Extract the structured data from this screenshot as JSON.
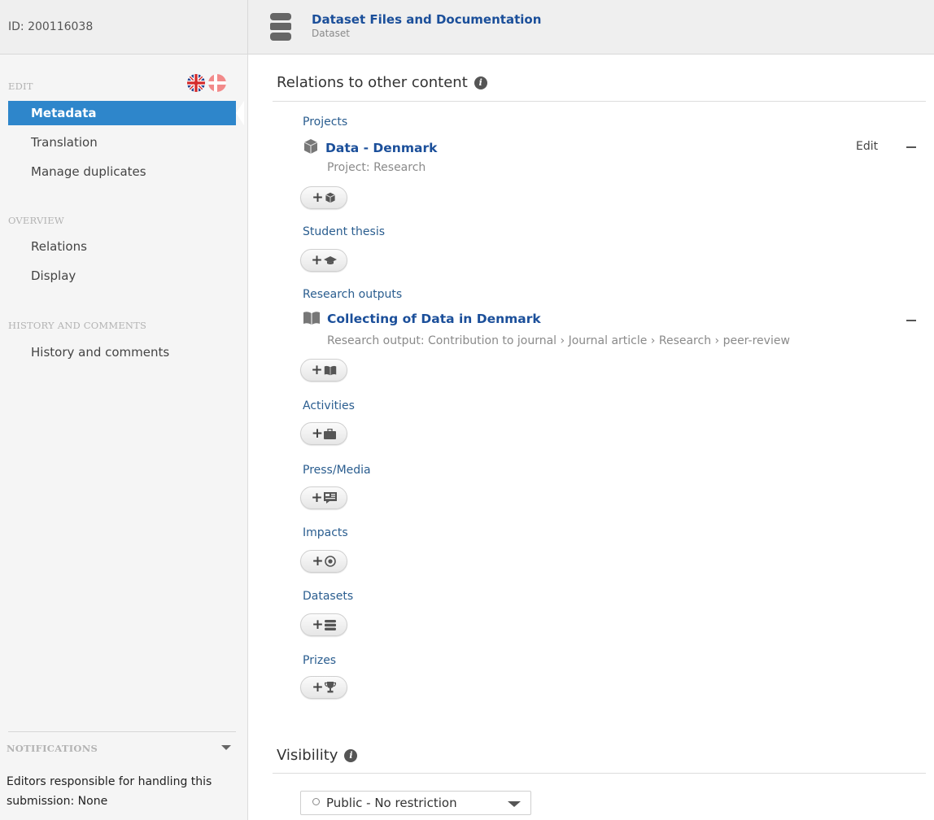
{
  "header": {
    "id_label": "ID: 200116038",
    "title": "Dataset Files and Documentation",
    "subtitle": "Dataset",
    "icon": "database-icon"
  },
  "sidebar": {
    "edit_heading": "EDIT",
    "edit_items": [
      "Metadata",
      "Translation",
      "Manage duplicates"
    ],
    "active_item": "Metadata",
    "overview_heading": "OVERVIEW",
    "overview_items": [
      "Relations",
      "Display"
    ],
    "history_heading": "HISTORY AND COMMENTS",
    "history_items": [
      "History and comments"
    ],
    "language_flags": [
      "uk-flag-icon",
      "denmark-flag-icon"
    ],
    "notifications_heading": "NOTIFICATIONS",
    "notifications_text": "Editors responsible for handling this submission: None"
  },
  "relations": {
    "title": "Relations to other content",
    "projects": {
      "label": "Projects",
      "item_title": "Data - Denmark",
      "item_sub": "Project: Research",
      "edit_label": "Edit",
      "icon": "cube-icon"
    },
    "student_thesis": {
      "label": "Student thesis",
      "icon": "graduation-cap-icon"
    },
    "research_outputs": {
      "label": "Research outputs",
      "item_title": "Collecting of Data in Denmark",
      "item_sub": "Research output: Contribution to journal › Journal article › Research › peer-review",
      "icon": "book-icon"
    },
    "activities": {
      "label": "Activities",
      "icon": "briefcase-icon"
    },
    "press_media": {
      "label": "Press/Media",
      "icon": "newspaper-icon"
    },
    "impacts": {
      "label": "Impacts",
      "icon": "target-icon"
    },
    "datasets": {
      "label": "Datasets",
      "icon": "database-icon"
    },
    "prizes": {
      "label": "Prizes",
      "icon": "trophy-icon"
    }
  },
  "visibility": {
    "title": "Visibility",
    "selected": "Public - No restriction"
  },
  "colors": {
    "accent": "#2e86cb",
    "link": "#1b4f9a",
    "group_label": "#2a5d8f"
  }
}
